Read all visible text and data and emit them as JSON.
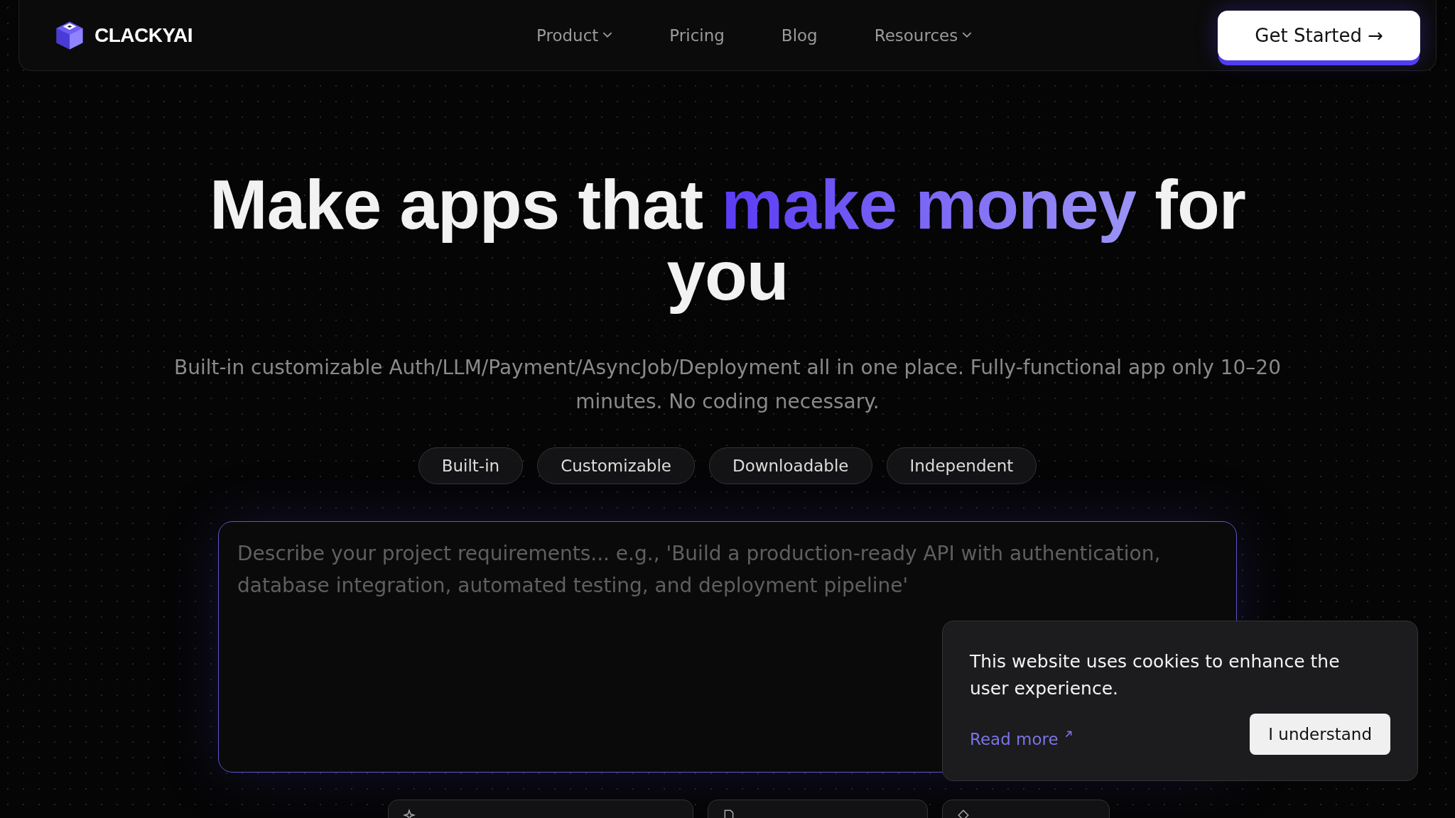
{
  "nav": {
    "brand": "CLACKYAI",
    "links": [
      {
        "label": "Product",
        "dropdown": true
      },
      {
        "label": "Pricing",
        "dropdown": false
      },
      {
        "label": "Blog",
        "dropdown": false
      },
      {
        "label": "Resources",
        "dropdown": true
      }
    ],
    "cta": "Get Started →"
  },
  "hero": {
    "headline": [
      {
        "text": "Make apps that ",
        "accent": false
      },
      {
        "text": "make money",
        "accent": true
      },
      {
        "text": " for you",
        "accent": false
      }
    ],
    "subtitle": "Built-in customizable Auth/LLM/Payment/AsyncJob/Deployment all in one place. Fully-functional app only 10–20 minutes. No coding necessary.",
    "tags": [
      "Built-in",
      "Customizable",
      "Downloadable",
      "Independent"
    ],
    "prompt": {
      "placeholder": "Describe your project requirements... e.g., 'Build a production-ready API with authentication, database integration, automated testing, and deployment pipeline'"
    },
    "suggestion_chips": [
      {
        "kind": "sparkle"
      },
      {
        "kind": "document"
      },
      {
        "kind": "diamond"
      }
    ]
  },
  "cookie_banner": {
    "message": "This website uses cookies to enhance the user experience.",
    "link": "Read more",
    "button": "I understand"
  }
}
